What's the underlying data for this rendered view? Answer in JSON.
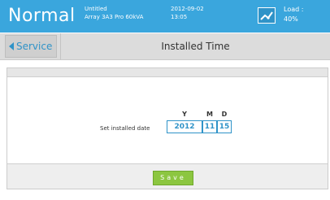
{
  "header": {
    "mode": "Normal",
    "project_name": "Untitled",
    "project_model": "Array 3A3 Pro 60kVA",
    "date": "2012-09-02",
    "time": "13:05",
    "load_label": "Load :",
    "load_value": "40%",
    "colors": {
      "bar": "#3aa6dd"
    }
  },
  "nav": {
    "back_label": "Service",
    "title": "Installed Time"
  },
  "form": {
    "label": "Set installed date",
    "columns": [
      "Y",
      "M",
      "D"
    ],
    "year": "2012",
    "month": "11",
    "day": "15"
  },
  "actions": {
    "save_label": "Save"
  },
  "icons": {
    "load": "load-meter-icon",
    "back": "left-arrow-icon"
  }
}
